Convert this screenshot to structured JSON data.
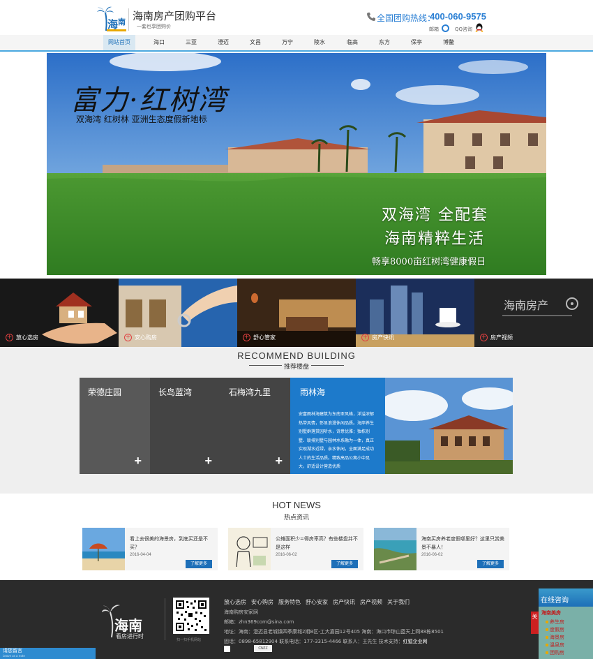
{
  "header": {
    "site_title": "海南房产团购平台",
    "slogan": "一套也享团购价",
    "hotline_label": "全国团购热线：",
    "hotline_number": "400-060-9575",
    "mail_label": "邮箱",
    "qq_label": "QQ咨询"
  },
  "nav": {
    "items": [
      "网站首页",
      "海口",
      "三亚",
      "澄迈",
      "文昌",
      "万宁",
      "陵水",
      "临高",
      "东方",
      "保亭",
      "博鳌"
    ]
  },
  "banner": {
    "title": "富力·红树湾",
    "subtitle": "双海湾 红树林 亚洲生态度假新地标",
    "line1": "双海湾 全配套",
    "line2": "海南精粹生活",
    "line3": "畅享8000亩红树湾健康假日"
  },
  "tiles": [
    {
      "label": "放心选房"
    },
    {
      "label": "安心购房"
    },
    {
      "label": "舒心管家"
    },
    {
      "label": "房产快讯"
    },
    {
      "label": "房产视频",
      "overlay": "海南房产"
    }
  ],
  "recommend": {
    "title": "RECOMMEND BUILDING",
    "subtitle": "推荐楼盘",
    "cards": [
      "荣德庄园",
      "长岛蓝湾",
      "石梅湾九里"
    ],
    "featured_name": "雨林海",
    "featured_desc": "安富雨林海建筑为东南亚风格，洋溢浓郁热带风情，彰显浪漫休闲品质。海岸养生别墅群落赏园听水，诗意优雅；独栋别墅、联排别墅与园林水系融为一体，真正实现湖水近绿，亲水休闲，全面满足成功人士的生活品质。精致高品公寓小中见大，舒适设计营造优质"
  },
  "news": {
    "title": "HOT NEWS",
    "subtitle": "热点资讯",
    "more_label": "了解更多",
    "items": [
      {
        "text": "看上去很美的海景房，到底买还是不买？",
        "date": "2016-04-04"
      },
      {
        "text": "公摊面积少=得房率高？有些楼盘并不是这样",
        "date": "2016-06-02"
      },
      {
        "text": "海南买房养老度假哪里好？这里只赏美景不暴人！",
        "date": "2016-06-02"
      }
    ]
  },
  "footer": {
    "logo_text": "海南",
    "logo_sub": "看房进行时",
    "qr_caption": "扫一扫手机网站",
    "links": [
      "放心选房",
      "安心购房",
      "服务特色",
      "舒心安家",
      "房产快讯",
      "房产视频",
      "关于我们"
    ],
    "company": "海南购房安家网",
    "email": "邮箱：zhn369com@sina.com",
    "address": "地址：海南：澄迈县老城镇四季康城2期B区-工大嘉园12号405 海南：海口市琼山蓝天上网88栋8501",
    "phone_line": "固话：0898-65812904  联系电话：177-3315-4466  联系人：王先生  技术支持：",
    "tech_support": "红狐企业网",
    "badge": "CNZZ",
    "leave_msg": "请您留言",
    "leave_msg_sub": "Leave us a note"
  },
  "consult": {
    "title": "在线咨询",
    "group": "海南美房",
    "items": [
      "养生房",
      "度假房",
      "海景房",
      "温泉房",
      "团购房"
    ],
    "close": "关"
  }
}
